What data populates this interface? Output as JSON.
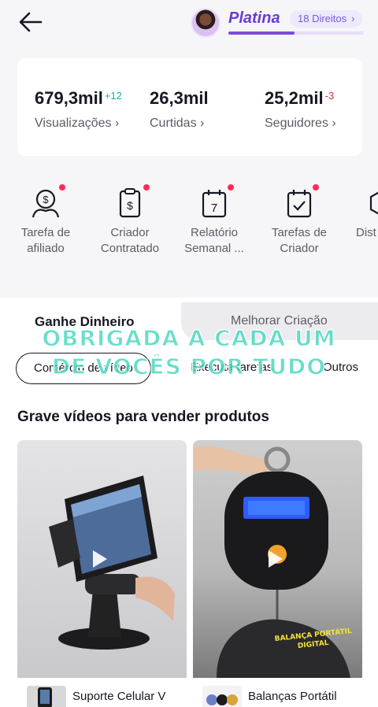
{
  "header": {
    "tier": "Platina",
    "rights": "18 Direitos",
    "rights_chevron": "›"
  },
  "stats": [
    {
      "value": "679,3mil",
      "delta": "+12",
      "label": "Visualizações ›"
    },
    {
      "value": "26,3mil",
      "delta": "",
      "label": "Curtidas ›"
    },
    {
      "value": "25,2mil",
      "delta": "-3",
      "label": "Seguidores ›"
    }
  ],
  "tools": [
    {
      "icon": "affiliate-icon",
      "label": "Tarefa de\nafiliado"
    },
    {
      "icon": "contract-icon",
      "label": "Criador\nContratado"
    },
    {
      "icon": "calendar-7-icon",
      "label": "Relatório\nSemanal ..."
    },
    {
      "icon": "calendar-check-icon",
      "label": "Tarefas de\nCriador"
    },
    {
      "icon": "hexagon-icon",
      "label": "Dist"
    }
  ],
  "tabs": {
    "earn": "Ganhe Dinheiro",
    "improve": "Melhorar Criação"
  },
  "chips": [
    "Comércio de vídeo",
    "Executa tarefas",
    "Outros"
  ],
  "overlay": {
    "line1": "OBRIGADA A CADA UM",
    "line2": "DE VOCÊS POR TUDO"
  },
  "section_title": "Grave vídeos para vender produtos",
  "products": [
    {
      "name": "Suporte Celular V",
      "image": "phone-holder"
    },
    {
      "name": "Balanças Portátil",
      "image": "portable-scale",
      "video_caption": "BALANÇA PORTÁTIL DIGITAL"
    }
  ],
  "colors": {
    "accent": "#6a3bd8",
    "up": "#16b39a",
    "down": "#e0304f",
    "badge_dot": "#fe2c55"
  }
}
